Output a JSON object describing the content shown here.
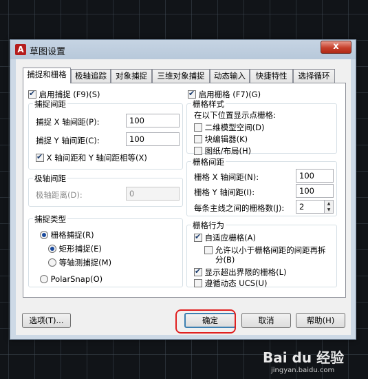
{
  "window": {
    "title": "草图设置",
    "app_icon_letter": "A",
    "close_glyph": "x"
  },
  "tabs": [
    {
      "label": "捕捉和栅格",
      "active": true
    },
    {
      "label": "极轴追踪"
    },
    {
      "label": "对象捕捉"
    },
    {
      "label": "三维对象捕捉"
    },
    {
      "label": "动态输入"
    },
    {
      "label": "快捷特性"
    },
    {
      "label": "选择循环"
    }
  ],
  "snap": {
    "enable_label": "启用捕捉 (F9)(S)",
    "enabled": true,
    "spacing_group": "捕捉间距",
    "x_label": "捕捉 X 轴间距(P):",
    "x_value": "100",
    "y_label": "捕捉 Y 轴间距(C):",
    "y_value": "100",
    "equal_label": "X 轴间距和 Y 轴间距相等(X)",
    "equal_checked": true,
    "polar_group": "极轴间距",
    "polar_label": "极轴距离(D):",
    "polar_value": "0",
    "type_group": "捕捉类型",
    "grid_snap_label": "栅格捕捉(R)",
    "rect_snap_label": "矩形捕捉(E)",
    "iso_snap_label": "等轴测捕捉(M)",
    "polar_snap_label": "PolarSnap(O)"
  },
  "grid": {
    "enable_label": "启用栅格 (F7)(G)",
    "enabled": true,
    "style_group": "栅格样式",
    "style_hint": "在以下位置显示点栅格:",
    "style_2d_label": "二维模型空间(D)",
    "style_block_label": "块编辑器(K)",
    "style_paper_label": "图纸/布局(H)",
    "spacing_group": "栅格间距",
    "x_label": "栅格 X 轴间距(N):",
    "x_value": "100",
    "y_label": "栅格 Y 轴间距(I):",
    "y_value": "100",
    "major_label": "每条主线之间的栅格数(J):",
    "major_value": "2",
    "behavior_group": "栅格行为",
    "adaptive_label": "自适应栅格(A)",
    "subdivide_label_1": "允许以小于栅格间距的间距再拆",
    "subdivide_label_2": "分(B)",
    "beyond_limits_label": "显示超出界限的栅格(L)",
    "follow_ucs_label": "遵循动态 UCS(U)"
  },
  "buttons": {
    "options": "选项(T)...",
    "ok": "确定",
    "cancel": "取消",
    "help": "帮助(H)"
  },
  "watermark": {
    "main": "Bai du 经验",
    "sub": "jingyan.baidu.com"
  },
  "colors": {
    "highlight_ring": "#e02020",
    "accent": "#3c7fb1"
  }
}
